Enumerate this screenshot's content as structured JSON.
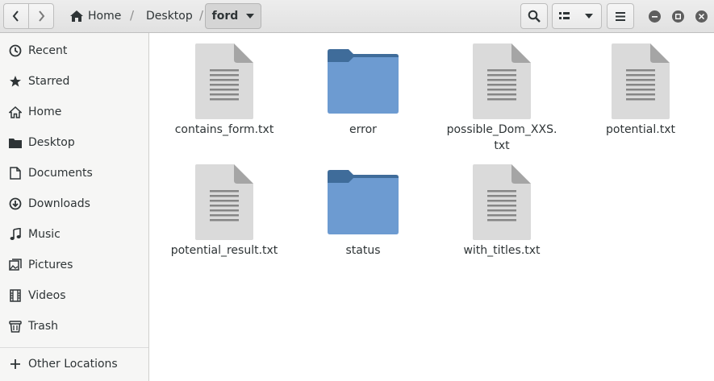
{
  "header": {
    "back_icon": "chevron-left-icon",
    "forward_icon": "chevron-right-icon",
    "breadcrumb": {
      "home_label": "Home",
      "desktop_label": "Desktop",
      "current_label": "ford",
      "separator": "/"
    }
  },
  "sidebar": {
    "items": [
      {
        "label": "Recent",
        "icon": "clock-icon"
      },
      {
        "label": "Starred",
        "icon": "star-icon"
      },
      {
        "label": "Home",
        "icon": "home-icon"
      },
      {
        "label": "Desktop",
        "icon": "folder-icon"
      },
      {
        "label": "Documents",
        "icon": "document-icon"
      },
      {
        "label": "Downloads",
        "icon": "download-icon"
      },
      {
        "label": "Music",
        "icon": "music-icon"
      },
      {
        "label": "Pictures",
        "icon": "pictures-icon"
      },
      {
        "label": "Videos",
        "icon": "film-icon"
      },
      {
        "label": "Trash",
        "icon": "trash-icon"
      }
    ],
    "other_locations": {
      "label": "Other Locations",
      "icon": "plus-icon"
    }
  },
  "files": [
    {
      "name": "contains_form.txt",
      "type": "text"
    },
    {
      "name": "error",
      "type": "folder"
    },
    {
      "name": "possible_Dom_XXS.\ntxt",
      "type": "text"
    },
    {
      "name": "potential.txt",
      "type": "text"
    },
    {
      "name": "potential_result.txt",
      "type": "text"
    },
    {
      "name": "status",
      "type": "folder"
    },
    {
      "name": "with_titles.txt",
      "type": "text"
    }
  ],
  "colors": {
    "folder_front": "#6d9bd1",
    "folder_back": "#3f6c9a",
    "document": "#dadada"
  }
}
